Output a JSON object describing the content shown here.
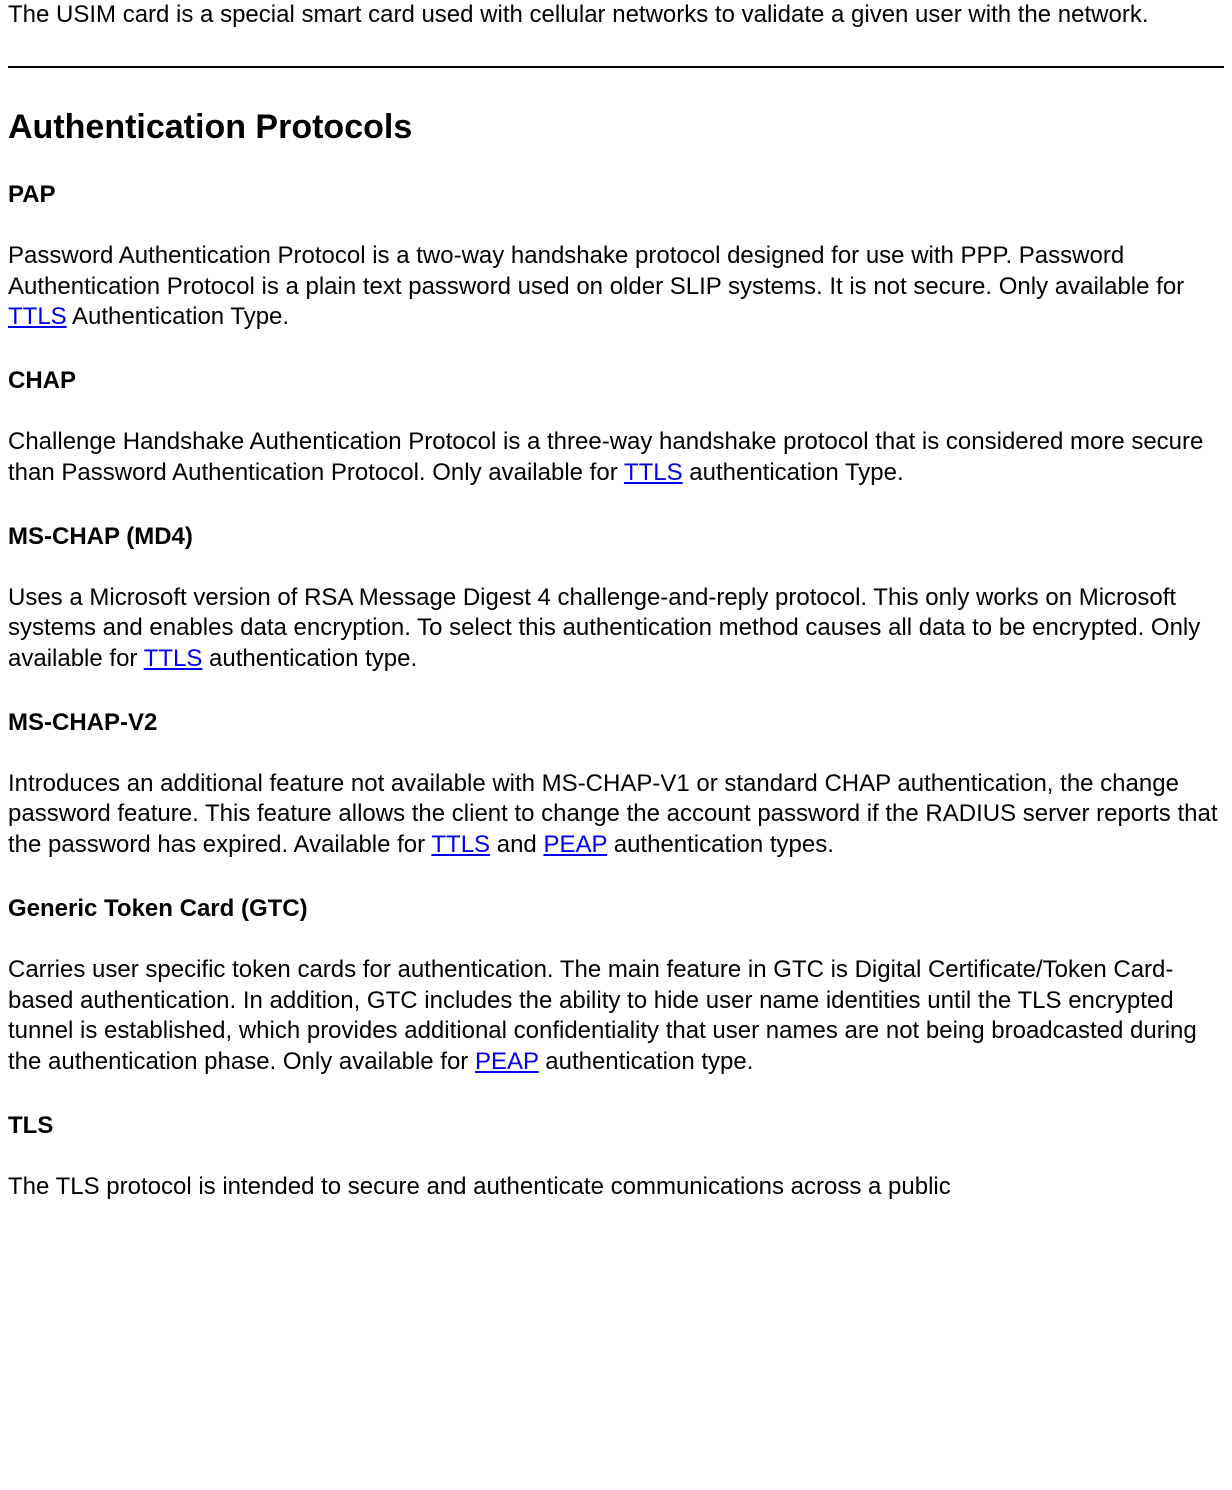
{
  "intro": "The USIM card is a special smart card used with cellular networks to validate a given user with the network.",
  "heading": "Authentication Protocols",
  "sections": [
    {
      "title": "PAP",
      "p_a": "Password Authentication Protocol is a two-way handshake protocol designed for use with PPP. Password Authentication Protocol is a plain text password used on older SLIP systems. It is not secure. Only available for ",
      "link1": "TTLS",
      "p_b": " Authentication Type."
    },
    {
      "title": "CHAP",
      "p_a": "Challenge Handshake Authentication Protocol is a three-way handshake protocol that is considered more secure than Password Authentication Protocol. Only available for ",
      "link1": "TTLS",
      "p_b": " authentication Type."
    },
    {
      "title": "MS-CHAP (MD4)",
      "p_a": "Uses a Microsoft version of RSA Message Digest 4 challenge-and-reply protocol. This only works on Microsoft systems and enables data encryption. To select this authentication method causes all data to be encrypted. Only available for ",
      "link1": "TTLS",
      "p_b": " authentication type."
    },
    {
      "title": "MS-CHAP-V2",
      "p_a": "Introduces an additional feature not available with MS-CHAP-V1 or standard CHAP authentication, the change password feature. This feature allows the client to change the account password if the RADIUS server reports that the password has expired. Available for ",
      "link1": "TTLS",
      "p_b": " and ",
      "link2": "PEAP",
      "p_c": " authentication types."
    },
    {
      "title": "Generic Token Card (GTC)",
      "p_a": "Carries user specific token cards for authentication. The main feature in GTC is Digital Certificate/Token Card-based authentication. In addition, GTC includes the ability to hide user name identities until the TLS encrypted tunnel is established, which provides additional confidentiality that user names are not being broadcasted during the authentication phase. Only available for ",
      "link1": "PEAP",
      "p_b": " authentication type."
    },
    {
      "title": "TLS",
      "p_a": "The TLS protocol is intended to secure and authenticate communications across a public"
    }
  ]
}
